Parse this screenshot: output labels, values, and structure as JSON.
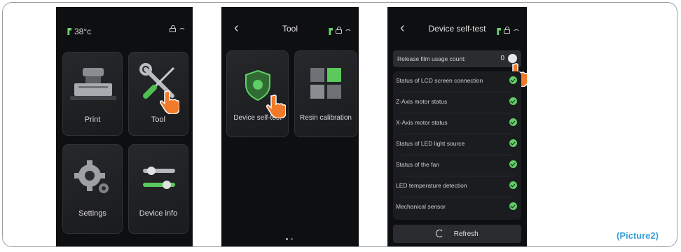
{
  "screen1": {
    "temperature": "38°c",
    "tiles": [
      {
        "label": "Print",
        "icon": "printer-icon"
      },
      {
        "label": "Tool",
        "icon": "wrench-screwdriver-icon"
      },
      {
        "label": "Settings",
        "icon": "gear-icon"
      },
      {
        "label": "Device info",
        "icon": "sliders-icon"
      }
    ]
  },
  "screen2": {
    "title": "Tool",
    "tiles": [
      {
        "label": "Device self-test",
        "icon": "shield-icon"
      },
      {
        "label": "Resin calibration",
        "icon": "cubes-icon"
      }
    ]
  },
  "screen3": {
    "title": "Device self-test",
    "release_film": {
      "label": "Release film usage count:",
      "value": "0"
    },
    "checks": [
      "Status of LCD screen connection",
      "Z-Axis motor status",
      "X-Axis motor status",
      "Status of LED light source",
      "Status of the fan",
      "LED temperature detection",
      "Mechanical sensor"
    ],
    "refresh_label": "Refresh"
  },
  "caption": "(Picture2)",
  "colors": {
    "accent_green": "#5fcf65",
    "caption_blue": "#3aa0dc",
    "pointer_orange": "#f07a2a"
  }
}
